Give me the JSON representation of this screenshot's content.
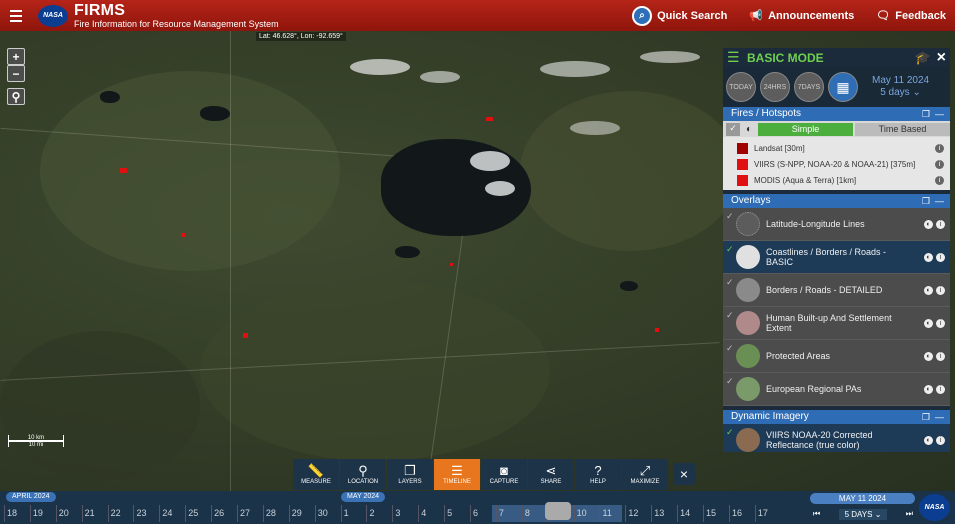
{
  "header": {
    "logo_text": "NASA",
    "title": "FIRMS",
    "subtitle": "Fire Information for Resource Management System",
    "quick_search": "Quick Search",
    "announcements": "Announcements",
    "feedback": "Feedback"
  },
  "map": {
    "coords": "Lat: 46.628°, Lon: -92.659°",
    "zoom_in": "+",
    "zoom_out": "−",
    "scale_km": "10 km",
    "scale_mi": "10 mi"
  },
  "toolbar": {
    "items": [
      {
        "label": "MEASURE",
        "icon": "📏"
      },
      {
        "label": "LOCATION",
        "icon": "⚲"
      },
      {
        "label": "LAYERS",
        "icon": "❐"
      },
      {
        "label": "TIMELINE",
        "icon": "☰"
      },
      {
        "label": "CAPTURE",
        "icon": "◙"
      },
      {
        "label": "SHARE",
        "icon": "⋖"
      },
      {
        "label": "HELP",
        "icon": "?"
      },
      {
        "label": "MAXIMIZE",
        "icon": "⤢"
      }
    ],
    "close": "×"
  },
  "timeline": {
    "month_left": "APRIL 2024",
    "month_right": "MAY 2024",
    "days": [
      "18",
      "19",
      "20",
      "21",
      "22",
      "23",
      "24",
      "25",
      "26",
      "27",
      "28",
      "29",
      "30",
      "1",
      "2",
      "3",
      "4",
      "5",
      "6",
      "7",
      "8",
      "9",
      "10",
      "11",
      "12",
      "13",
      "14",
      "15",
      "16",
      "17"
    ],
    "current_date": "MAY 11 2024",
    "range": "5 DAYS"
  },
  "panel": {
    "mode": "BASIC MODE",
    "date_buttons": [
      "TODAY",
      "24HRS",
      "7DAYS"
    ],
    "date": "May 11 2024",
    "range": "5 days",
    "fires_header": "Fires / Hotspots",
    "fire_modes": [
      "Simple",
      "Time Based"
    ],
    "fire_layers": [
      {
        "label": "Landsat [30m]",
        "color": "#a00000"
      },
      {
        "label": "VIIRS (S-NPP, NOAA-20 & NOAA-21) [375m]",
        "color": "#e01010"
      },
      {
        "label": "MODIS (Aqua & Terra) [1km]",
        "color": "#e01010"
      }
    ],
    "overlays_header": "Overlays",
    "overlays": [
      {
        "label": "Latitude-Longitude Lines"
      },
      {
        "label": "Coastlines / Borders / Roads - BASIC"
      },
      {
        "label": "Borders / Roads - DETAILED"
      },
      {
        "label": "Human Built-up And Settlement Extent"
      },
      {
        "label": "Protected Areas"
      },
      {
        "label": "European Regional PAs"
      }
    ],
    "dynamic_header": "Dynamic Imagery",
    "dynamic_item": "VIIRS NOAA-20 Corrected Reflectance (true color)"
  }
}
